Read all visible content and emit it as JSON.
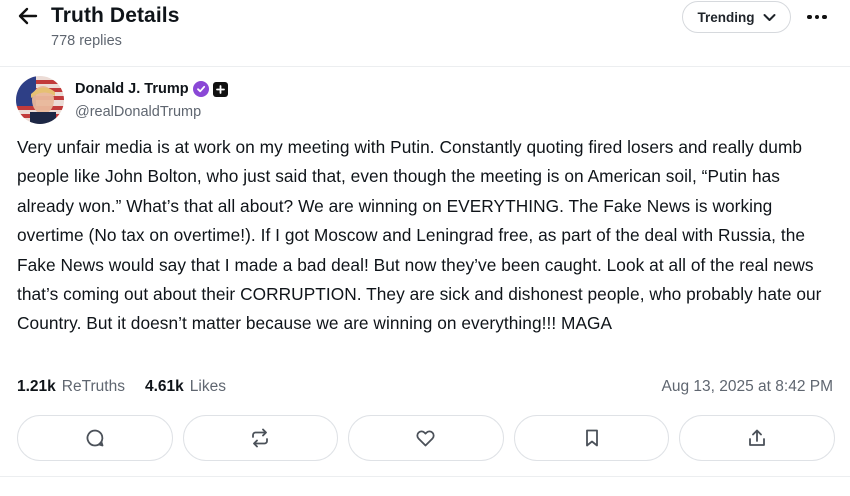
{
  "header": {
    "title": "Truth Details",
    "replies": "778 replies",
    "trending_label": "Trending"
  },
  "post": {
    "author_name": "Donald J. Trump",
    "handle": "@realDonaldTrump",
    "text": "Very unfair media is at work on my meeting with Putin. Constantly quoting fired losers and really dumb people like John Bolton, who just said that, even though the meeting is on American soil, “Putin has already won.” What’s that all about? We are winning on EVERYTHING. The Fake News is working overtime (No tax on overtime!). If I got Moscow and Leningrad free, as part of the deal with Russia, the Fake News would say that I made a bad deal! But now they’ve been caught. Look at all of the real news that’s coming out about their CORRUPTION. They are sick and dishonest people, who probably hate our Country. But it doesn’t matter because we are winning on everything!!! MAGA",
    "retruths_count": "1.21k",
    "retruths_label": "ReTruths",
    "likes_count": "4.61k",
    "likes_label": "Likes",
    "timestamp": "Aug 13, 2025 at 8:42 PM"
  },
  "icons": {
    "back": "arrow-left-icon",
    "dropdown": "chevron-down-icon",
    "more": "more-horizontal-icon",
    "verified": "verified-badge-icon",
    "plus": "plus-square-icon",
    "reply": "comment-icon",
    "retruth": "repost-icon",
    "like": "heart-icon",
    "bookmark": "bookmark-icon",
    "share": "share-icon"
  },
  "colors": {
    "verified_badge": "#8a48d6",
    "secondary_text": "#5f6670",
    "primary_text": "#0f1419"
  }
}
